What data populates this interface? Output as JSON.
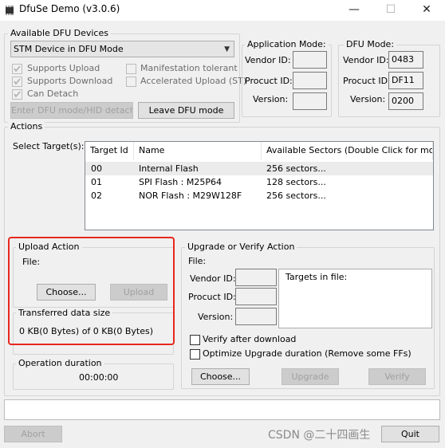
{
  "window": {
    "title": "DfuSe Demo (v3.0.6)",
    "minimize": "—",
    "maximize": "☐",
    "close": "✕"
  },
  "devices": {
    "legend": "Available DFU Devices",
    "selected": "STM Device in DFU Mode",
    "checks": [
      {
        "label": "Supports Upload",
        "checked": true
      },
      {
        "label": "Supports Download",
        "checked": true
      },
      {
        "label": "Can Detach",
        "checked": true
      },
      {
        "label": "Manifestation tolerant",
        "checked": false
      },
      {
        "label": "Accelerated Upload (ST)",
        "checked": false
      }
    ],
    "enter_dfu": "Enter DFU mode/HID detach",
    "leave_dfu": "Leave DFU mode"
  },
  "app_mode": {
    "legend": "Application Mode:",
    "vendor_label": "Vendor ID:",
    "product_label": "Procuct ID:",
    "version_label": "Version:",
    "vendor": "",
    "product": "",
    "version": ""
  },
  "dfu_mode": {
    "legend": "DFU Mode:",
    "vendor_label": "Vendor ID:",
    "product_label": "Procuct ID:",
    "version_label": "Version:",
    "vendor": "0483",
    "product": "DF11",
    "version": "0200"
  },
  "actions": {
    "legend": "Actions",
    "select_target": "Select Target(s):",
    "columns": [
      "Target Id",
      "Name",
      "Available Sectors (Double Click for more)"
    ],
    "rows": [
      {
        "id": "00",
        "name": "Internal Flash",
        "sectors": "256 sectors..."
      },
      {
        "id": "01",
        "name": "SPI Flash : M25P64",
        "sectors": "128 sectors..."
      },
      {
        "id": "02",
        "name": "NOR Flash : M29W128F",
        "sectors": "256 sectors..."
      }
    ]
  },
  "upload": {
    "legend": "Upload Action",
    "file_label": "File:",
    "choose": "Choose...",
    "upload": "Upload"
  },
  "transferred": {
    "legend": "Transferred data size",
    "value": "0 KB(0 Bytes) of 0 KB(0 Bytes)"
  },
  "duration": {
    "legend": "Operation duration",
    "value": "00:00:00"
  },
  "upgrade": {
    "legend": "Upgrade or Verify Action",
    "file_label": "File:",
    "vendor_label": "Vendor ID:",
    "product_label": "Procuct ID:",
    "version_label": "Version:",
    "targets_label": "Targets in file:",
    "verify_after": "Verify after download",
    "optimize": "Optimize Upgrade duration (Remove some FFs)",
    "choose": "Choose...",
    "upgrade": "Upgrade",
    "verify": "Verify"
  },
  "bottom": {
    "abort": "Abort",
    "quit": "Quit",
    "watermark": "CSDN @二十四画生"
  },
  "colors": {
    "highlight": "#e8281e",
    "selection": "#ebebeb"
  }
}
